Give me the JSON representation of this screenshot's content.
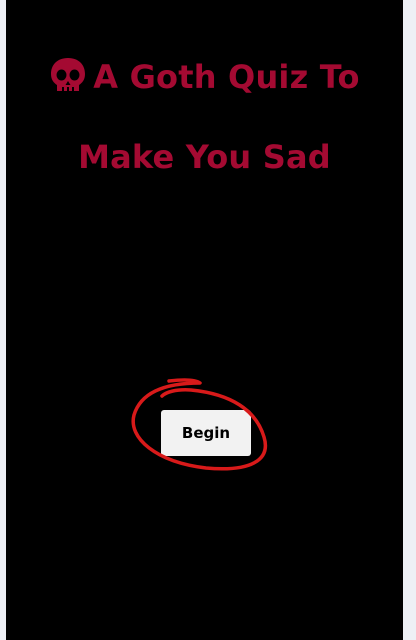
{
  "quiz": {
    "title_line1": "A Goth Quiz To",
    "title_line2": "Make You Sad",
    "title_icon": "skull-icon",
    "begin_label": "Begin"
  },
  "colors": {
    "background": "#000000",
    "title": "#a40a32",
    "button_bg": "#f2f2f2",
    "annotation": "#d81a1a",
    "page_margin": "#eef0f5"
  },
  "annotation": {
    "shape": "hand-drawn-circle",
    "target": "begin-button"
  }
}
